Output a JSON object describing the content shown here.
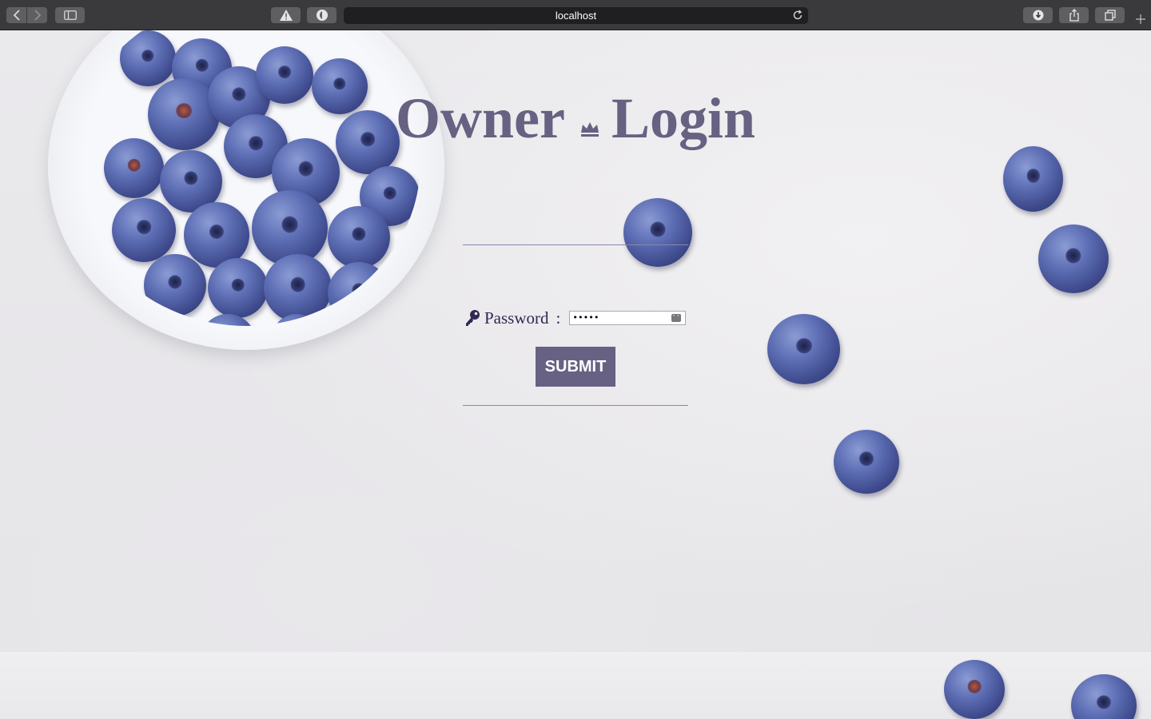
{
  "browser": {
    "url": "localhost",
    "icons": {
      "back": "chevron-left-icon",
      "forward": "chevron-right-icon",
      "sidebar": "sidebar-icon",
      "warning": "warning-icon",
      "shield": "privacy-shield-icon",
      "reload": "reload-icon",
      "download": "download-icon",
      "share": "share-icon",
      "tabs": "tab-overview-icon",
      "new_tab": "plus-icon"
    }
  },
  "login": {
    "title_left": "Owner",
    "title_icon": "crown-icon",
    "title_right": "Login",
    "password_label": "Password",
    "password_colon": ":",
    "password_value": "•••••",
    "password_icon": "key-icon",
    "submit_label": "SUBMIT"
  },
  "colors": {
    "accent": "#676183",
    "label_text": "#33284f",
    "divider": "#8a86ae",
    "toolbar": "#3a3a3c"
  }
}
